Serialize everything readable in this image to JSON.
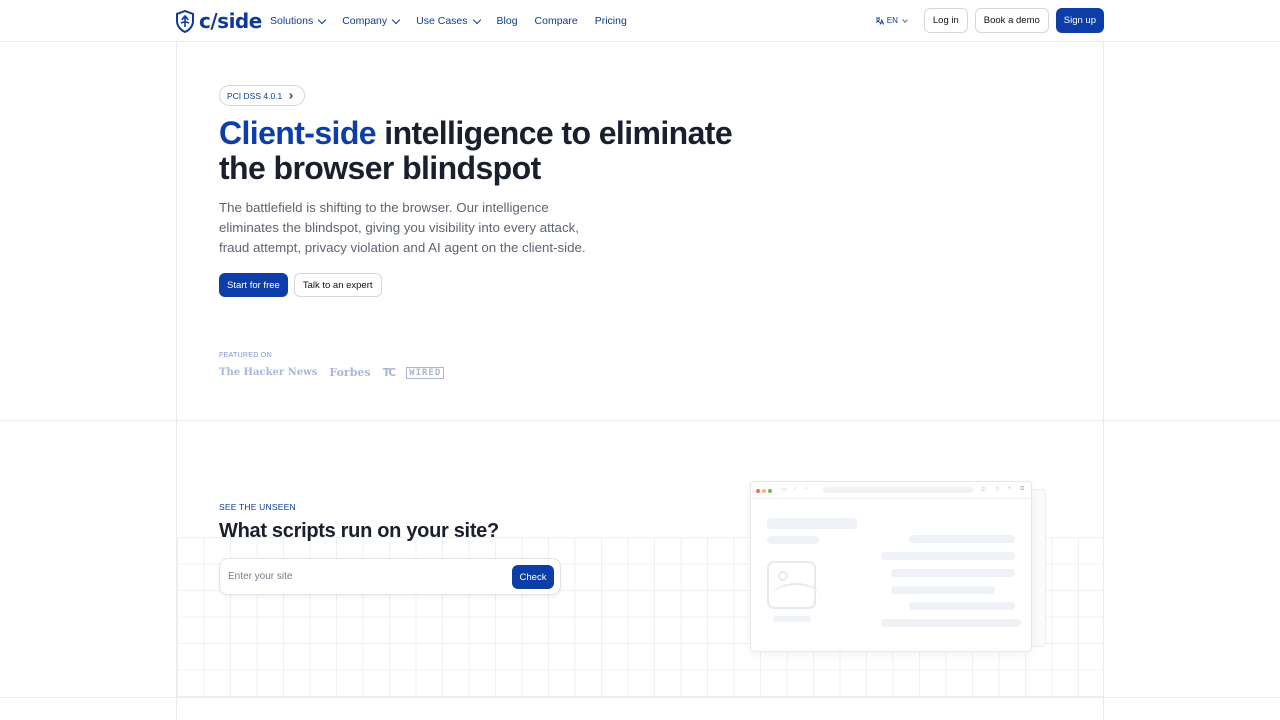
{
  "brand": {
    "name": "c/side"
  },
  "nav": {
    "items": [
      {
        "label": "Solutions",
        "dropdown": true
      },
      {
        "label": "Company",
        "dropdown": true
      },
      {
        "label": "Use Cases",
        "dropdown": true
      },
      {
        "label": "Blog",
        "dropdown": false
      },
      {
        "label": "Compare",
        "dropdown": false
      },
      {
        "label": "Pricing",
        "dropdown": false
      }
    ],
    "language": "EN",
    "login_label": "Log in",
    "demo_label": "Book a demo",
    "signup_label": "Sign up"
  },
  "hero": {
    "badge": "PCI DSS 4.0.1",
    "title_accent": "Client-side",
    "title_rest": " intelligence to eliminate the browser blindspot",
    "description": "The battlefield is shifting to the browser. Our intelligence eliminates the blindspot, giving you visibility into every attack, fraud attempt, privacy violation and AI agent on the client-side.",
    "primary_cta": "Start for free",
    "secondary_cta": "Talk to an expert",
    "featured_label": "FEATURED ON",
    "featured_logos": {
      "hacker_news": "The Hacker News",
      "forbes": "Forbes",
      "techcrunch": "TC",
      "wired": "WIRED"
    }
  },
  "scan": {
    "eyebrow": "SEE THE UNSEEN",
    "title": "What scripts run on your site?",
    "placeholder": "Enter your site",
    "button": "Check"
  },
  "colors": {
    "brand": "#0d3b97",
    "primary_button": "#0d3ea8",
    "text": "#1a1f2e",
    "muted": "#5d6472",
    "border": "#e8eaee"
  }
}
